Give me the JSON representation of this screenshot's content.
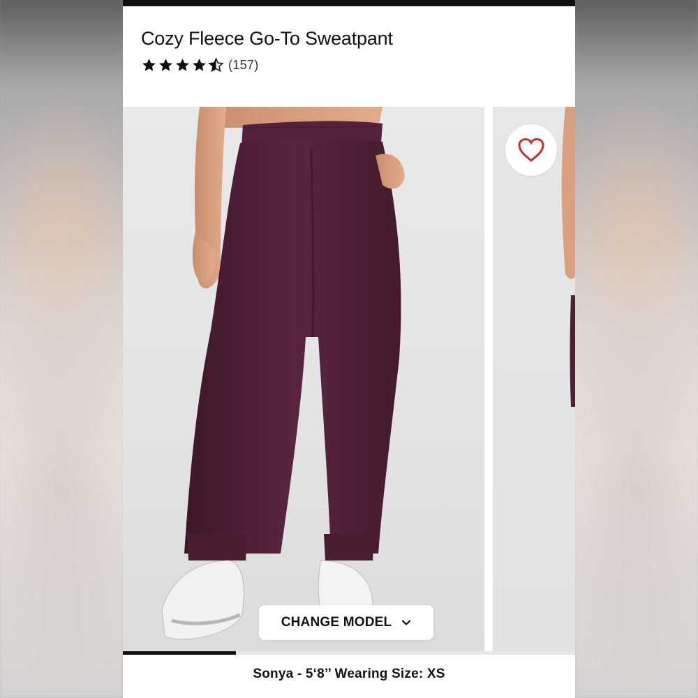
{
  "product": {
    "title": "Cozy Fleece Go-To Sweatpant",
    "rating": 4.5,
    "review_count": "(157)"
  },
  "gallery": {
    "image_main_alt": "Model wearing plum sweatpants with white sneakers",
    "image_next_alt": "Next product image",
    "change_model_label": "CHANGE MODEL",
    "progress": 0.25
  },
  "model_info": "Sonya - 5‘8’’ Wearing Size: XS",
  "icons": {
    "favorite": "heart-outline-icon",
    "dropdown": "chevron-down-icon",
    "rating": "star-icon"
  },
  "colors": {
    "heart": "#c0302e",
    "pants": "#4e1f35",
    "ink": "#111111"
  }
}
